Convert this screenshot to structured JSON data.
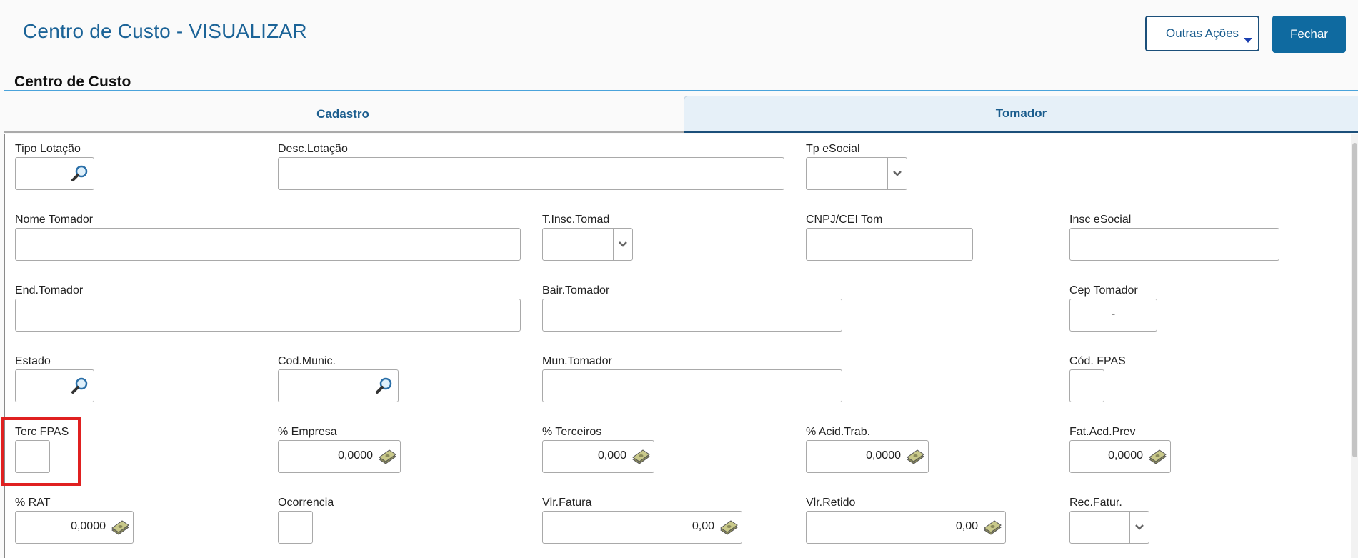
{
  "page": {
    "title": "Centro de Custo - VISUALIZAR"
  },
  "actions": {
    "other_label": "Outras Ações",
    "close_label": "Fechar"
  },
  "section": {
    "title": "Centro de Custo"
  },
  "tabs": [
    {
      "label": "Cadastro",
      "active": false
    },
    {
      "label": "Tomador",
      "active": true
    }
  ],
  "fields": {
    "tipo_lotacao": {
      "label": "Tipo Lotação",
      "value": ""
    },
    "desc_lotacao": {
      "label": "Desc.Lotação",
      "value": ""
    },
    "tp_esocial": {
      "label": "Tp eSocial",
      "value": ""
    },
    "nome_tomador": {
      "label": "Nome Tomador",
      "value": ""
    },
    "t_insc_tomad": {
      "label": "T.Insc.Tomad",
      "value": ""
    },
    "cnpj_cei_tom": {
      "label": "CNPJ/CEI Tom",
      "value": ""
    },
    "insc_esocial": {
      "label": "Insc eSocial",
      "value": ""
    },
    "end_tomador": {
      "label": "End.Tomador",
      "value": ""
    },
    "bair_tomador": {
      "label": "Bair.Tomador",
      "value": ""
    },
    "cep_tomador": {
      "label": "Cep Tomador",
      "value": "-"
    },
    "estado": {
      "label": "Estado",
      "value": ""
    },
    "cod_munic": {
      "label": "Cod.Munic.",
      "value": ""
    },
    "mun_tomador": {
      "label": "Mun.Tomador",
      "value": ""
    },
    "cod_fpas": {
      "label": "Cód. FPAS",
      "value": ""
    },
    "terc_fpas": {
      "label": "Terc FPAS",
      "value": ""
    },
    "pct_empresa": {
      "label": "% Empresa",
      "value": "0,0000"
    },
    "pct_terceiros": {
      "label": "% Terceiros",
      "value": "0,000"
    },
    "pct_acid_trab": {
      "label": "% Acid.Trab.",
      "value": "0,0000"
    },
    "fat_acd_prev": {
      "label": "Fat.Acd.Prev",
      "value": "0,0000"
    },
    "pct_rat": {
      "label": "% RAT",
      "value": "0,0000"
    },
    "ocorrencia": {
      "label": "Ocorrencia",
      "value": ""
    },
    "vlr_fatura": {
      "label": "Vlr.Fatura",
      "value": "0,00"
    },
    "vlr_retido": {
      "label": "Vlr.Retido",
      "value": "0,00"
    },
    "rec_fatur": {
      "label": "Rec.Fatur.",
      "value": ""
    }
  },
  "icons": {
    "lookup": "magnifier-icon",
    "calculator": "money-icon",
    "dropdown": "chevron-down-icon"
  },
  "colors": {
    "accent": "#1b6397",
    "primary_button": "#0f6aa0",
    "highlight": "#e02020"
  }
}
